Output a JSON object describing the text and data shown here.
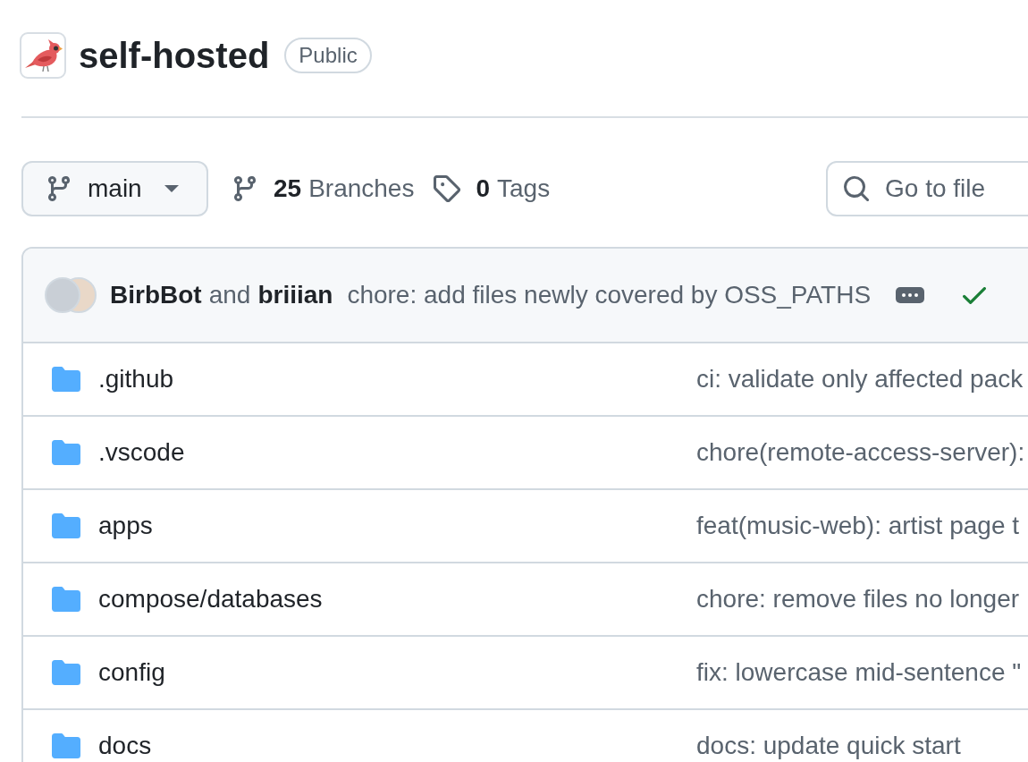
{
  "repo": {
    "name": "self-hosted",
    "visibility": "Public"
  },
  "toolbar": {
    "branch": "main",
    "branches": {
      "count": "25",
      "label": "Branches"
    },
    "tags": {
      "count": "0",
      "label": "Tags"
    },
    "search": {
      "placeholder": "Go to file"
    }
  },
  "latest_commit": {
    "authors": [
      {
        "name": "BirbBot"
      },
      {
        "name": "briiian"
      }
    ],
    "joiner": "and",
    "message": "chore: add files newly covered by OSS_PATHS",
    "checks_passed": true
  },
  "files": [
    {
      "name": ".github",
      "message": "ci: validate only affected pack"
    },
    {
      "name": ".vscode",
      "message": "chore(remote-access-server):"
    },
    {
      "name": "apps",
      "message": "feat(music-web): artist page t"
    },
    {
      "name": "compose/databases",
      "message": "chore: remove files no longer"
    },
    {
      "name": "config",
      "message": "fix: lowercase mid-sentence \""
    },
    {
      "name": "docs",
      "message": "docs: update quick start"
    }
  ]
}
